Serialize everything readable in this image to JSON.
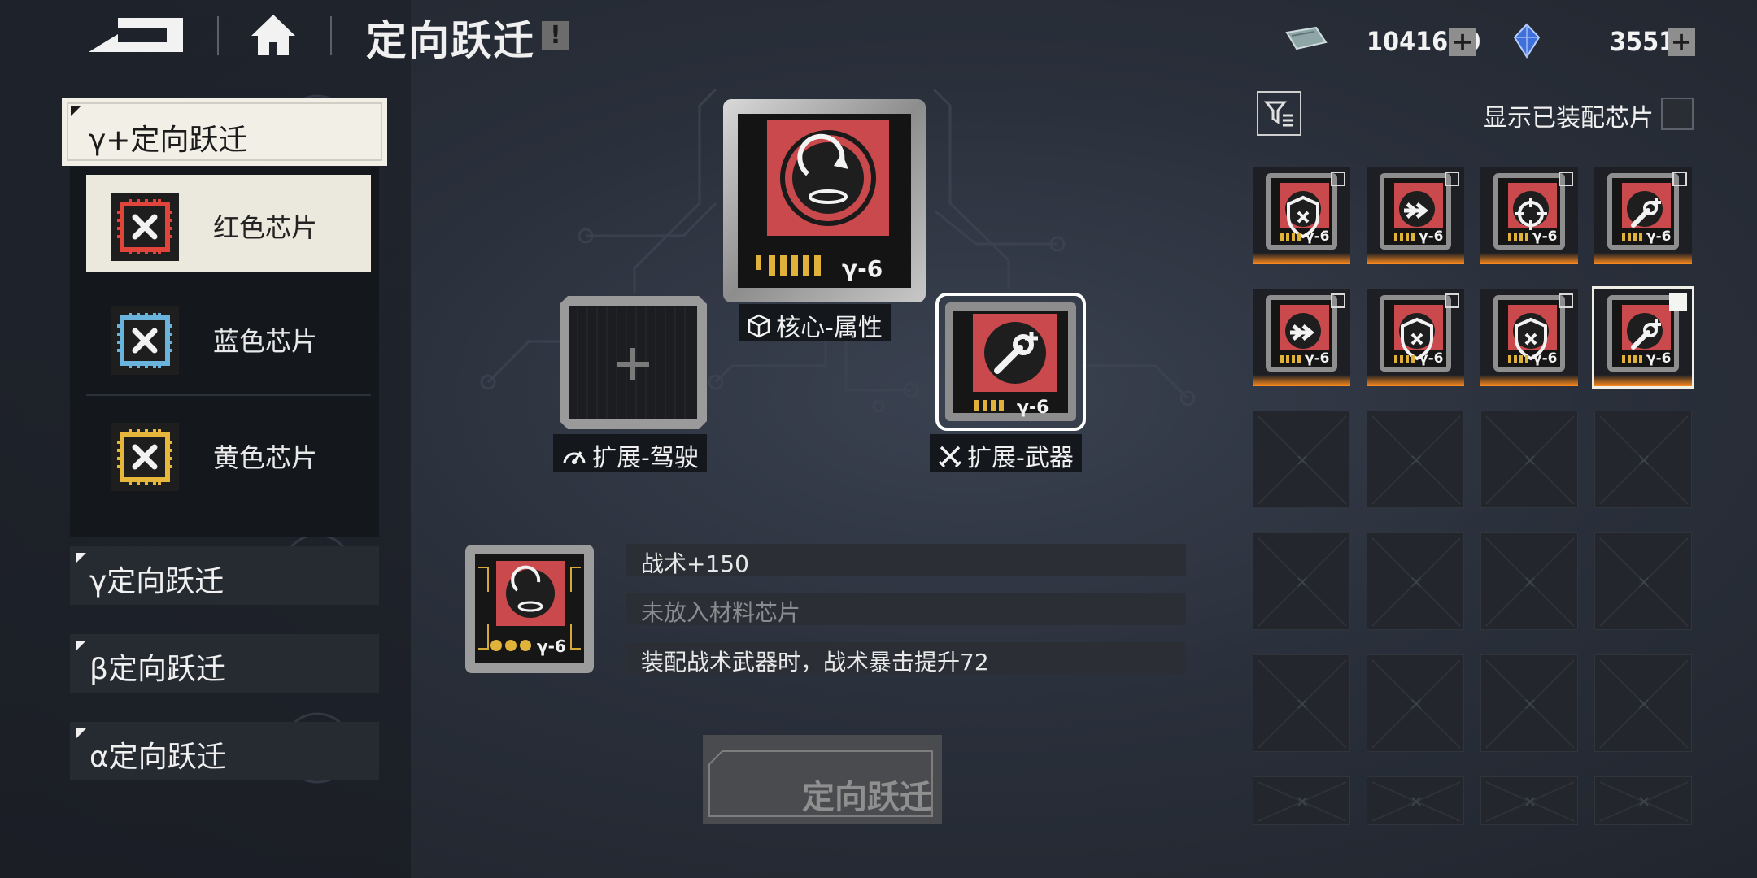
{
  "header": {
    "title": "定向跃迁",
    "info_badge": "!",
    "currency_1": {
      "icon": "credit-ticket-icon",
      "value": "1041690"
    },
    "currency_2": {
      "icon": "crystal-icon",
      "value": "35518"
    },
    "plus": "+"
  },
  "left_panel": {
    "expanded_tier": "γ+定向跃迁",
    "chips": [
      {
        "label": "红色芯片",
        "color": "#e0443a",
        "active": true
      },
      {
        "label": "蓝色芯片",
        "color": "#6ab3dc",
        "active": false
      },
      {
        "label": "黄色芯片",
        "color": "#e7b73b",
        "active": false
      }
    ],
    "tiers": [
      "γ定向跃迁",
      "β定向跃迁",
      "α定向跃迁"
    ]
  },
  "slots": {
    "core": {
      "label": "核心-属性",
      "chip_code": "γ-6"
    },
    "drive": {
      "label": "扩展-驾驶",
      "plus": "+"
    },
    "weapon": {
      "label": "扩展-武器",
      "chip_code": "γ-6"
    }
  },
  "details": {
    "chip_code": "γ-6",
    "stats": [
      "战术+150",
      "未放入材料芯片",
      "装配战术武器时，战术暴击提升72"
    ]
  },
  "action": {
    "label": "定向跃迁"
  },
  "inventory": {
    "show_equipped_label": "显示已装配芯片",
    "show_equipped_checked": false,
    "items": [
      {
        "icon": "shield-icon",
        "code": "γ-6"
      },
      {
        "icon": "dash-arrow-icon",
        "code": "γ-6"
      },
      {
        "icon": "crosshair-icon",
        "code": "γ-6"
      },
      {
        "icon": "wrench-plus-icon",
        "code": "γ-6"
      },
      {
        "icon": "dash-arrow-icon",
        "code": "γ-6"
      },
      {
        "icon": "shield-icon",
        "code": "γ-6"
      },
      {
        "icon": "shield-icon",
        "code": "γ-6"
      },
      {
        "icon": "wrench-plus-icon",
        "code": "γ-6",
        "selected": true
      }
    ]
  }
}
